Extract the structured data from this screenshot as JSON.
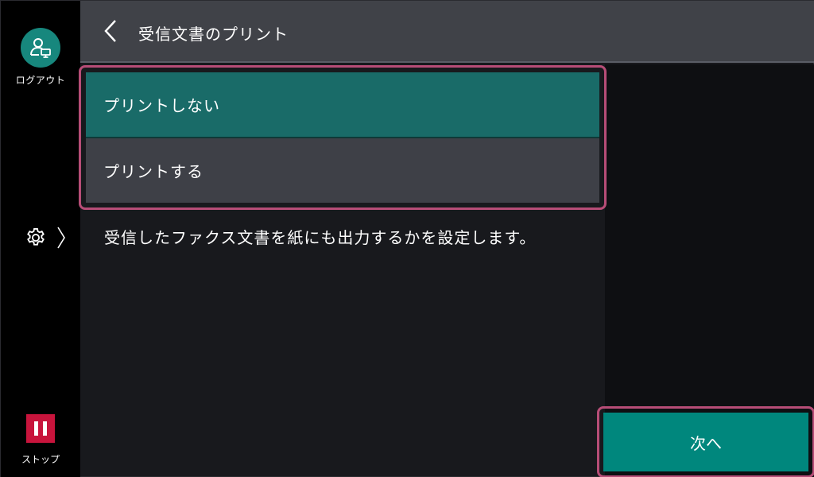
{
  "rail": {
    "logout_label": "ログアウト",
    "stop_label": "ストップ"
  },
  "header": {
    "title": "受信文書のプリント"
  },
  "options": [
    {
      "label": "プリントしない",
      "selected": true
    },
    {
      "label": "プリントする",
      "selected": false
    }
  ],
  "description": "受信したファクス文書を紙にも出力するかを設定します。",
  "next_label": "次へ",
  "colors": {
    "accent": "#00877d",
    "selected": "#196b68",
    "focus_border": "#b74d77",
    "stop": "#c8143c"
  },
  "icons": [
    "user-logout-icon",
    "gear-icon",
    "chevron-right-icon",
    "back-chevron-icon",
    "pause-icon"
  ]
}
